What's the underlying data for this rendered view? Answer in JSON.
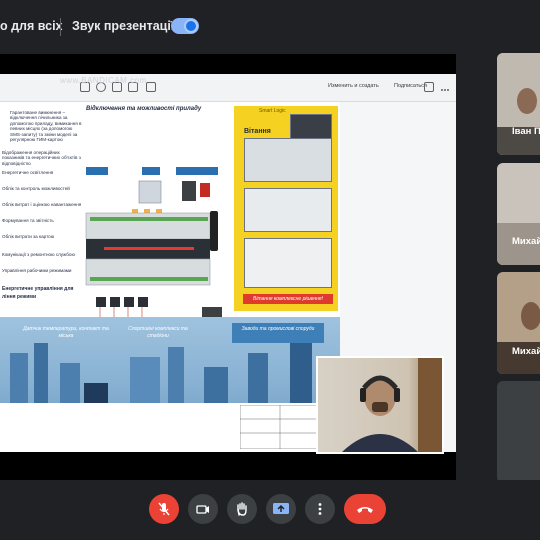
{
  "topbar": {
    "captions_label": "о для всіх",
    "sound_label": "Звук презентації",
    "sound_toggle_on": true
  },
  "browser": {
    "watermark": "www.BANDICAM.com",
    "collect_label": "Изменить и создать",
    "sign_label": "Подписаться"
  },
  "document": {
    "left_panel": {
      "intro": "Гарантоване вимкнення – відключення лічильника за допомогою приладу, вимикання в певних місцях (за допомогою SMS-запиту) та зміни моделі за регулярною ГИМ-картою",
      "items": [
        "Відображення операційних показників та енергетичних об'єктів з відповідністю",
        "Енергетичне освітлення",
        "Облік та контроль можливостей",
        "Облік витрат і оцінкою навантаження",
        "Формування та звітність",
        "Облік витрати за картою",
        "Комунікації з ремонтною службою",
        "Управління рабочими режимами"
      ],
      "bottom_head": "Енергетичне управління для",
      "bottom_head2": "ління режими"
    },
    "mid_title": "Відключення та можливості приладу",
    "yellow_panel": {
      "brand": "Smart Logic",
      "title": "Вітання",
      "footer": "Вітання комплексне рішення!"
    },
    "city_boxes": [
      "Датчик температури, контакт та міська",
      "Спортивні комплекси та стадіони",
      "Заводи та промислові споруди"
    ]
  },
  "participants": [
    {
      "name": "Іван П"
    },
    {
      "name": "Михай"
    },
    {
      "name": "Михай"
    }
  ],
  "controls": [
    {
      "name": "mic",
      "state": "muted"
    },
    {
      "name": "camera",
      "state": "on"
    },
    {
      "name": "raise-hand",
      "state": "off"
    },
    {
      "name": "present",
      "state": "active"
    },
    {
      "name": "more",
      "state": "off"
    },
    {
      "name": "end-call",
      "state": "off"
    }
  ],
  "colors": {
    "background": "#202124",
    "accent": "#8ab4f8",
    "danger": "#ea4335",
    "yellow_panel": "#f5d122"
  }
}
